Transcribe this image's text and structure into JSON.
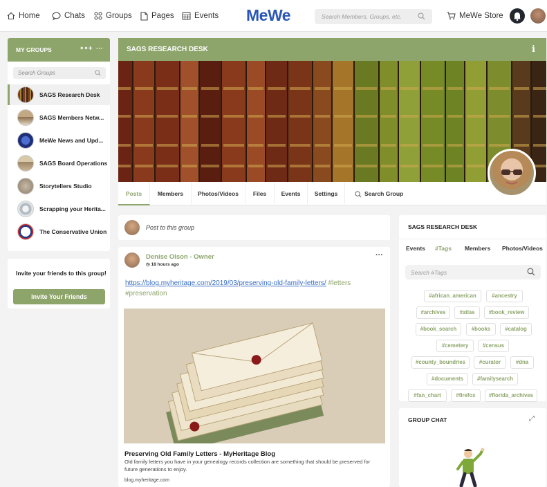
{
  "nav": {
    "home": "Home",
    "chats": "Chats",
    "groups": "Groups",
    "pages": "Pages",
    "events": "Events",
    "logo": "MeWe",
    "search_placeholder": "Search Members, Groups, etc.",
    "store": "MeWe Store"
  },
  "sidebar": {
    "title": "MY GROUPS",
    "search_placeholder": "Search Groups",
    "groups": [
      {
        "name": "SAGS Research Desk",
        "active": true
      },
      {
        "name": "SAGS Members Netw..."
      },
      {
        "name": "MeWe News and Upd..."
      },
      {
        "name": "SAGS Board Operations"
      },
      {
        "name": "Storytellers Studio"
      },
      {
        "name": "Scrapping your Herita..."
      },
      {
        "name": "The Conservative Union"
      }
    ],
    "invite_text": "Invite your friends to this group!",
    "invite_button": "Invite Your Friends"
  },
  "group": {
    "name": "SAGS RESEARCH DESK",
    "tabs": [
      "Posts",
      "Members",
      "Photos/Videos",
      "Files",
      "Events",
      "Settings",
      "Search Group"
    ],
    "active_tab": "Posts"
  },
  "composer": {
    "placeholder": "Post to this group"
  },
  "post": {
    "author": "Denise Olson - Owner",
    "time": "18 hours ago",
    "link": "https://blog.myheritage.com/2019/03/preserving-old-family-letters/",
    "hashtags_inline": "#letters",
    "hashtags_line2": "#preservation",
    "link_title": "Preserving Old Family Letters - MyHeritage Blog",
    "link_desc": "Old family letters you have in your genealogy records collection are something that should be preserved for future generations to enjoy.",
    "link_host": "blog.myheritage.com"
  },
  "right_panel": {
    "title": "SAGS RESEARCH DESK",
    "tabs": [
      "Events",
      "#Tags",
      "Members",
      "Photos/Videos"
    ],
    "active_tab": "#Tags",
    "tag_search_placeholder": "Search #Tags",
    "tags": [
      "#african_american",
      "#ancestry",
      "#archives",
      "#atlas",
      "#book_review",
      "#book_search",
      "#books",
      "#catalog",
      "#cemetery",
      "#census",
      "#county_boundries",
      "#curator",
      "#dna",
      "#documents",
      "#familysearch",
      "#fan_chart",
      "#firefox",
      "#florida_archives"
    ]
  },
  "chat": {
    "title": "GROUP CHAT"
  },
  "colors": {
    "accent": "#8da46a",
    "link": "#3a6fc4",
    "logo": "#2a56b8"
  }
}
